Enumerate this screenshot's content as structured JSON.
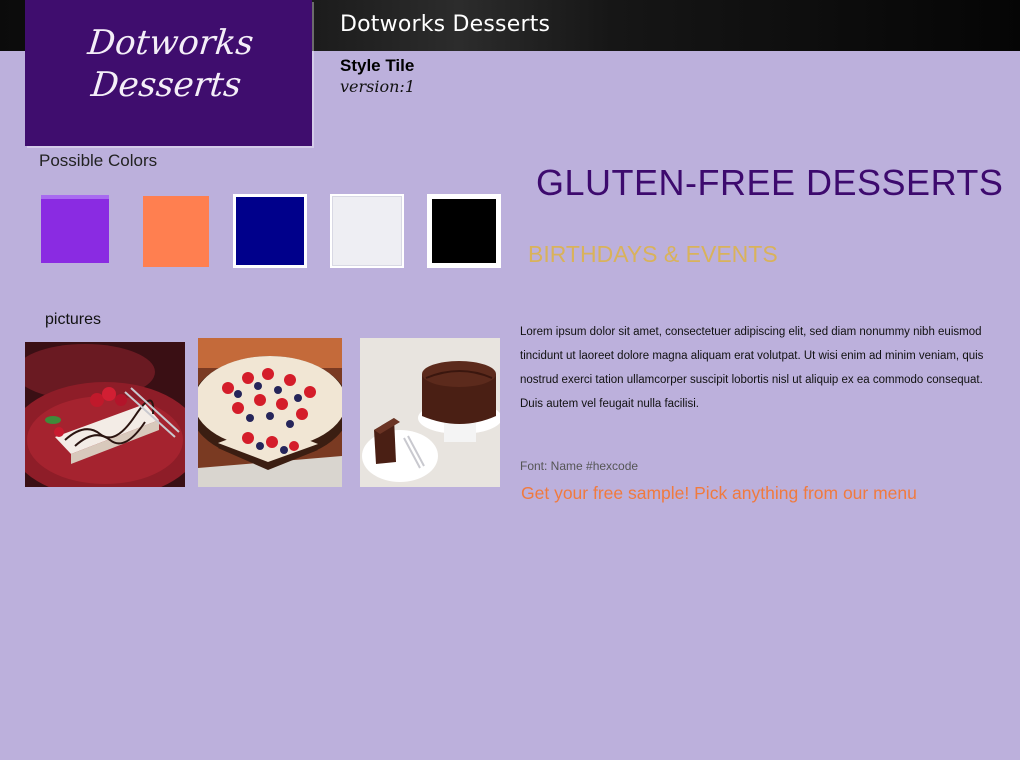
{
  "header": {
    "title": "Dotworks Desserts"
  },
  "logo": {
    "line1": "Dotworks",
    "line2": "Desserts"
  },
  "tile": {
    "name": "Style Tile",
    "version": "version:1"
  },
  "colors": {
    "heading": "Possible Colors",
    "swatches": [
      "#8a2be2",
      "#ff7f50",
      "#00008b",
      "#eeeef3",
      "#000000"
    ]
  },
  "pictures": {
    "heading": "pictures",
    "items": [
      "raspberry-cheesecake-photo",
      "berry-brownie-tart-photo",
      "chocolate-cake-photo"
    ]
  },
  "content": {
    "headline": "GLUTEN-FREE DESSERTS",
    "subhead": "BIRTHDAYS & EVENTS",
    "body": "Lorem ipsum dolor sit amet, consectetuer adipiscing elit, sed diam nonummy nibh euismod tincidunt ut laoreet dolore magna aliquam erat volutpat. Ut wisi enim ad minim veniam, quis nostrud exerci tation ullamcorper suscipit lobortis nisl ut aliquip ex ea commodo consequat. Duis autem vel feugait nulla facilisi.",
    "font_note": "Font: Name #hexcode",
    "cta": "Get your free sample! Pick anything from our menu"
  },
  "theme": {
    "background": "#bcb0dc",
    "headline_color": "#3d0a6e",
    "subhead_color": "#d9b25b",
    "cta_color": "#f07a3e",
    "logo_bg": "#3f0d6e"
  }
}
